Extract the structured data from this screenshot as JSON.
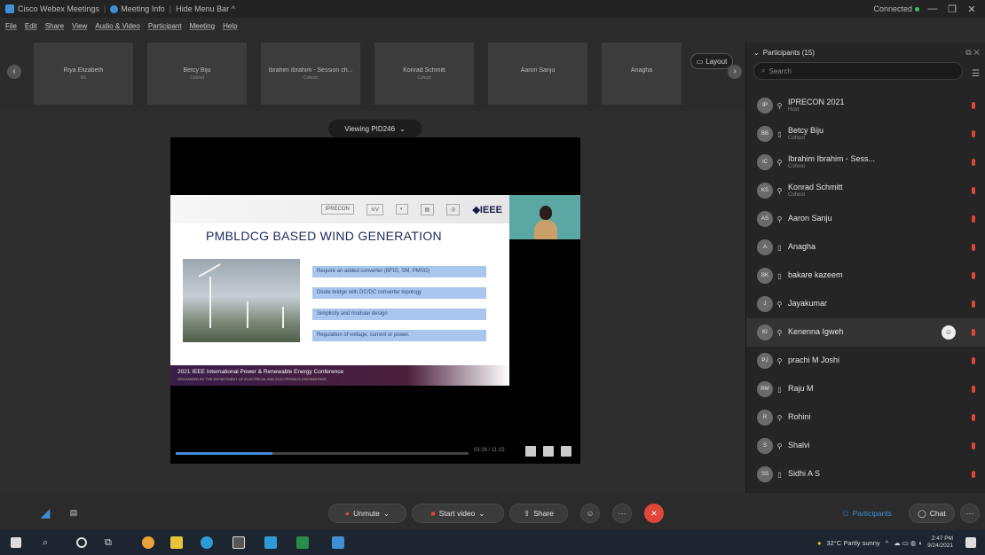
{
  "titlebar": {
    "app_title": "Cisco Webex Meetings",
    "meeting_info": "Meeting Info",
    "hide_menu": "Hide Menu Bar ^",
    "status": "Connected"
  },
  "menu": [
    "File",
    "Edit",
    "Share",
    "View",
    "Audio & Video",
    "Participant",
    "Meeting",
    "Help"
  ],
  "thumbnails": [
    {
      "name": "Riya Elizabeth",
      "role": "Ms"
    },
    {
      "name": "Betcy Biju",
      "role": "Cohost"
    },
    {
      "name": "Ibrahim Ibrahim - Session ch...",
      "role": "Cohost"
    },
    {
      "name": "Konrad Schmitt",
      "role": "Cohost"
    },
    {
      "name": "Aaron Sanju",
      "role": ""
    },
    {
      "name": "Anagha",
      "role": ""
    }
  ],
  "layout_label": "Layout",
  "viewing_label": "Viewing PID246",
  "slide": {
    "title": "PMBLDCG  BASED WIND GENERATION",
    "logos": [
      "IPRECON",
      "IEEE"
    ],
    "bullets": [
      "Require an added converter (BFIG, SM, PMSG)",
      "Diode bridge with DC/DC converter topology",
      "Simplicity and modular design",
      "Regulation of voltage, current or power."
    ],
    "footer": "2021 IEEE International Power & Renewable Energy Conference",
    "footer_sub": "ORGANISED BY THE DEPARTMENT OF ELECTRICAL AND ELECTRONICS ENGINEERING"
  },
  "video": {
    "timecode": "03:26 / 11:15",
    "progress_fraction": 0.33
  },
  "participants": {
    "header": "Participants (15)",
    "search_placeholder": "Search",
    "list": [
      {
        "initials": "IP",
        "name": "IPRECON 2021",
        "role": "Host",
        "type": "mic-icon"
      },
      {
        "initials": "BB",
        "name": "Betcy Biju",
        "role": "Cohost",
        "type": "phone-icon"
      },
      {
        "initials": "IC",
        "name": "Ibrahim Ibrahim - Sess...",
        "role": "Cohost",
        "type": "mic-icon"
      },
      {
        "initials": "KS",
        "name": "Konrad Schmitt",
        "role": "Cohost",
        "type": "mic-icon"
      },
      {
        "initials": "AS",
        "name": "Aaron Sanju",
        "role": "",
        "type": "mic-icon"
      },
      {
        "initials": "A",
        "name": "Anagha",
        "role": "",
        "type": "phone-icon"
      },
      {
        "initials": "BK",
        "name": "bakare kazeem",
        "role": "",
        "type": "phone-icon"
      },
      {
        "initials": "J",
        "name": "Jayakumar",
        "role": "",
        "type": "mic-icon"
      },
      {
        "initials": "KI",
        "name": "Kenenna Igweh",
        "role": "",
        "type": "mic-icon"
      },
      {
        "initials": "PJ",
        "name": "prachi M Joshi",
        "role": "",
        "type": "mic-icon"
      },
      {
        "initials": "RM",
        "name": "Raju M",
        "role": "",
        "type": "phone-icon"
      },
      {
        "initials": "R",
        "name": "Rohini",
        "role": "",
        "type": "mic-icon"
      },
      {
        "initials": "S",
        "name": "Shalvi",
        "role": "",
        "type": "mic-icon"
      },
      {
        "initials": "SS",
        "name": "Sidhi A S",
        "role": "",
        "type": "phone-icon"
      }
    ]
  },
  "controls": {
    "unmute": "Unmute",
    "start_video": "Start video",
    "share": "Share",
    "participants": "Participants",
    "chat": "Chat"
  },
  "taskbar": {
    "weather": "32°C  Partly sunny",
    "time": "2:47 PM",
    "date": "9/24/2021"
  },
  "colors": {
    "accent": "#3f8fd6",
    "end_red": "#e0473a",
    "muted_red": "#e0473a"
  }
}
